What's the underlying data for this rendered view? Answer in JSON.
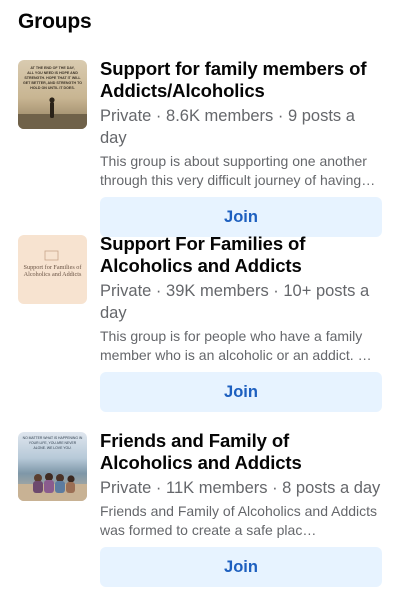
{
  "section": {
    "title": "Groups"
  },
  "groups": [
    {
      "name": "Support for family members of Addicts/Alcoholics",
      "meta": "Private · 8.6K members · 9 posts a day",
      "description": "This group is about supporting one another through this very difficult journey of having…",
      "join_label": "Join",
      "thumb_text": "AT THE END OF THE DAY, ALL YOU NEED IS HOPE AND STRENGTH. HOPE THAT IT WILL GET BETTER, AND STRENGTH TO HOLD ON UNTIL IT DOES."
    },
    {
      "name": "Support For Families of Alcoholics and Addicts",
      "meta": "Private · 39K members · 10+ posts a day",
      "description": "This group is for people who have a family member who is an alcoholic or an addict. …",
      "join_label": "Join",
      "thumb_text": "Support for Families of Alcoholics and Addicts"
    },
    {
      "name": "Friends and Family of Alcoholics and Addicts",
      "meta": "Private · 11K members · 8 posts a day",
      "description": "Friends and Family of Alcoholics and Addicts  was formed to create a safe plac…",
      "join_label": "Join",
      "thumb_text": "NO MATTER WHAT IS HAPPENING IN YOUR LIFE, YOU ARE NEVER ALONE. WE LOVE YOU."
    }
  ]
}
